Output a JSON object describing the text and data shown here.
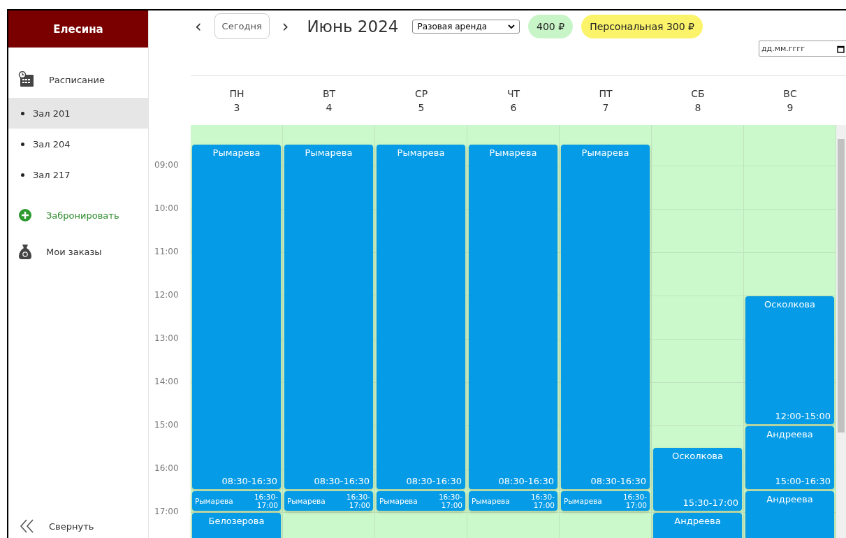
{
  "sidebar": {
    "title": "Елесина",
    "items": [
      {
        "kind": "schedule",
        "label": "Расписание",
        "selected": false
      },
      {
        "kind": "hall",
        "label": "Зал 201",
        "selected": true
      },
      {
        "kind": "hall",
        "label": "Зал 204",
        "selected": false
      },
      {
        "kind": "hall",
        "label": "Зал 217",
        "selected": false
      },
      {
        "kind": "book",
        "label": "Забронировать",
        "selected": false
      },
      {
        "kind": "orders",
        "label": "Мои заказы",
        "selected": false
      }
    ],
    "collapse": "Свернуть"
  },
  "toolbar": {
    "prev": "‹",
    "today": "Сегодня",
    "next": "›",
    "title": "Июнь 2024",
    "rent_type": "Разовая аренда",
    "prices": [
      {
        "label": "400 ₽",
        "color": "#c8f5c8"
      },
      {
        "label": "Персональная 300 ₽",
        "color": "#fbf36a"
      }
    ],
    "date_field": {
      "placeholder": "дд.мм.гггг"
    }
  },
  "calendar": {
    "days": [
      {
        "weekday": "ПН",
        "date": "3",
        "events": [
          {
            "name": "Рымарева",
            "time": "08:30-16:30"
          },
          {
            "name": "Рымарева",
            "time": "16:30-17:00"
          },
          {
            "name": "Белозерова"
          }
        ]
      },
      {
        "weekday": "ВТ",
        "date": "4",
        "events": [
          {
            "name": "Рымарева",
            "time": "08:30-16:30"
          },
          {
            "name": "Рымарева",
            "time": "16:30-17:00"
          }
        ]
      },
      {
        "weekday": "СР",
        "date": "5",
        "events": [
          {
            "name": "Рымарева",
            "time": "08:30-16:30"
          },
          {
            "name": "Рымарева",
            "time": "16:30-17:00"
          }
        ]
      },
      {
        "weekday": "ЧТ",
        "date": "6",
        "events": [
          {
            "name": "Рымарева",
            "time": "08:30-16:30"
          },
          {
            "name": "Рымарева",
            "time": "16:30-17:00"
          }
        ]
      },
      {
        "weekday": "ПТ",
        "date": "7",
        "events": [
          {
            "name": "Рымарева",
            "time": "08:30-16:30"
          },
          {
            "name": "Рымарева",
            "time": "16:30-17:00"
          }
        ]
      },
      {
        "weekday": "СБ",
        "date": "8",
        "events": [
          {
            "name": "Осколкова",
            "time": "15:30-17:00"
          },
          {
            "name": "Андреева"
          }
        ]
      },
      {
        "weekday": "ВС",
        "date": "9",
        "events": [
          {
            "name": "Осколкова",
            "time": "12:00-15:00"
          },
          {
            "name": "Андреева",
            "time": "15:00-16:30"
          },
          {
            "name": "Андреева"
          }
        ]
      }
    ],
    "hours": [
      "09:00",
      "10:00",
      "11:00",
      "12:00",
      "13:00",
      "14:00",
      "15:00",
      "16:00",
      "17:00"
    ]
  }
}
